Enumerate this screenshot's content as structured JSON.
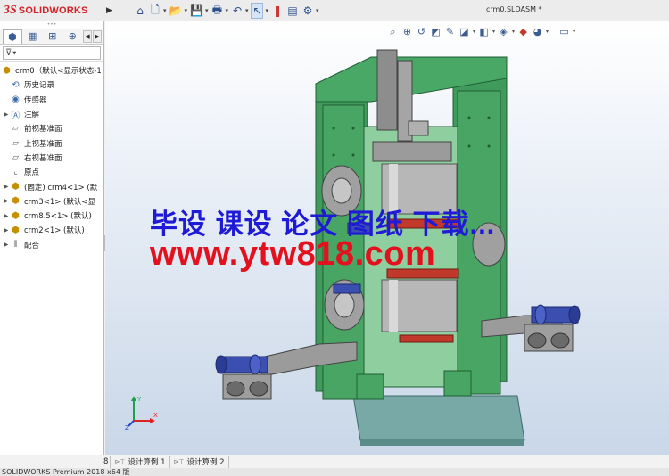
{
  "app": {
    "logo_mark": "3S",
    "logo_text": "SOLIDWORKS",
    "document_title": "crm0.SLDASM *"
  },
  "toolbar": {
    "menu_arrow": "▶",
    "icons": [
      "home-icon",
      "new-document-icon",
      "open-folder-icon",
      "save-icon",
      "print-icon",
      "undo-icon",
      "select-pointer-icon",
      "rebuild-icon",
      "file-properties-icon",
      "options-gear-icon"
    ]
  },
  "feature_manager": {
    "tabs": [
      "feature-manager-tab",
      "property-manager-tab",
      "configuration-manager-tab",
      "dimxpert-tab"
    ],
    "filter_label": "▼",
    "root": "crm0（默认<显示状态-1",
    "items": [
      {
        "label": "历史记录",
        "icon": "history-icon",
        "expandable": false
      },
      {
        "label": "传感器",
        "icon": "sensor-icon",
        "expandable": false
      },
      {
        "label": "注解",
        "icon": "annotation-icon",
        "expandable": true
      },
      {
        "label": "前视基准面",
        "icon": "plane-icon",
        "expandable": false
      },
      {
        "label": "上视基准面",
        "icon": "plane-icon",
        "expandable": false
      },
      {
        "label": "右视基准面",
        "icon": "plane-icon",
        "expandable": false
      },
      {
        "label": "原点",
        "icon": "origin-icon",
        "expandable": false
      },
      {
        "label": "(固定) crm4<1> (默",
        "icon": "subassembly-icon",
        "expandable": true
      },
      {
        "label": "crm3<1> (默认<显",
        "icon": "subassembly-icon",
        "expandable": true
      },
      {
        "label": "crm8.5<1> (默认)",
        "icon": "subassembly-icon",
        "expandable": true
      },
      {
        "label": "crm2<1> (默认)",
        "icon": "subassembly-icon",
        "expandable": true
      },
      {
        "label": "配合",
        "icon": "mates-icon",
        "expandable": true
      }
    ]
  },
  "viewport": {
    "watermark_line1": "毕设 课设 论文 图纸 下载...",
    "watermark_line2": "www.ytw818.com",
    "triad": {
      "x_label": "X",
      "y_label": "Y",
      "z_label": "Z"
    },
    "colors": {
      "frame_green": "#3f9a5c",
      "roll_gray": "#a8a8a8",
      "drive_blue": "#3b4fb0",
      "base_teal": "#78a9a6",
      "red_part": "#c0392b"
    }
  },
  "bottom_tabs": [
    "设计算例 1",
    "设计算例 2"
  ],
  "bottom_tab_cut": "8",
  "status": "SOLIDWORKS Premium 2018 x64 版"
}
